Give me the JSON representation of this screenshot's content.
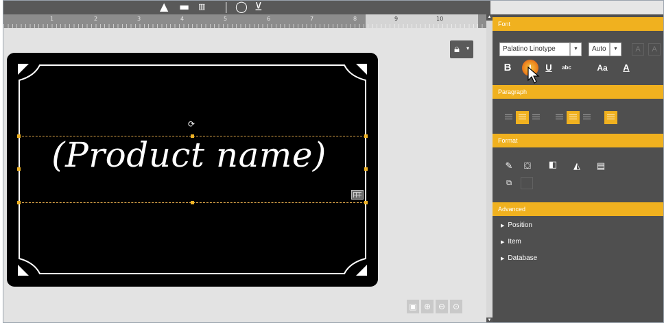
{
  "toolbar": {
    "icons": [
      "text-tool-icon",
      "image-tool-icon",
      "barcode-tool-icon",
      "shape-tool-icon",
      "variable-tool-icon"
    ]
  },
  "ruler": {
    "labels": [
      "1",
      "2",
      "3",
      "4",
      "5",
      "6",
      "7",
      "8",
      "9",
      "10"
    ]
  },
  "canvas": {
    "product_name": "(Product name)",
    "lock_icon": "lock-icon",
    "zoom_buttons": [
      "zoom-fit-icon",
      "zoom-in-icon",
      "zoom-out-icon",
      "zoom-reset-icon"
    ]
  },
  "panel": {
    "font": {
      "header": "Font",
      "family": "Palatino Linotype",
      "size": "Auto",
      "bold": "B",
      "italic": "I",
      "underline": "U",
      "strike": "abc",
      "case": "Aa",
      "color": "A"
    },
    "paragraph": {
      "header": "Paragraph"
    },
    "format": {
      "header": "Format"
    },
    "advanced": {
      "header": "Advanced",
      "items": [
        "Position",
        "Item",
        "Database"
      ]
    }
  },
  "colors": {
    "accent": "#f0b11f",
    "panel_bg": "#4f4f4f",
    "label_bg": "#000000"
  }
}
